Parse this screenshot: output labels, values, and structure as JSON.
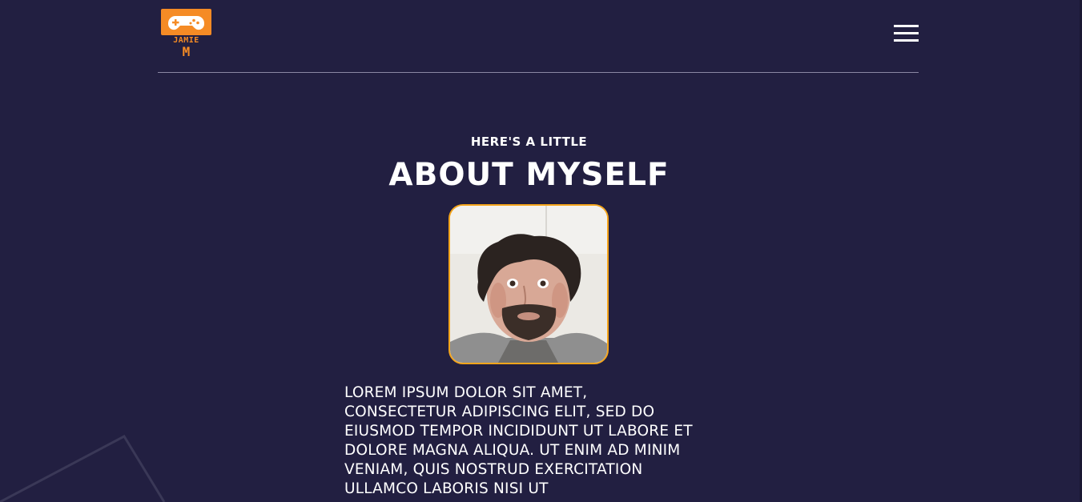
{
  "header": {
    "logo": {
      "icon": "gamepad-icon",
      "line1": "JAMIE",
      "line2": "M",
      "color": "#f58b25"
    },
    "menu_icon": "hamburger-menu-icon"
  },
  "about": {
    "eyebrow": "HERE'S A LITTLE",
    "title": "ABOUT MYSELF",
    "photo_alt": "Profile photo",
    "bio": "LOREM IPSUM DOLOR SIT AMET, CONSECTETUR ADIPISCING ELIT, SED DO EIUSMOD TEMPOR INCIDIDUNT UT LABORE ET DOLORE MAGNA ALIQUA. UT ENIM AD MINIM VENIAM, QUIS NOSTRUD EXERCITATION ULLAMCO LABORIS NISI UT"
  },
  "colors": {
    "background": "#221f41",
    "accent": "#f58b25",
    "photo_border": "#f5a51b",
    "divider": "#8a87a3"
  }
}
